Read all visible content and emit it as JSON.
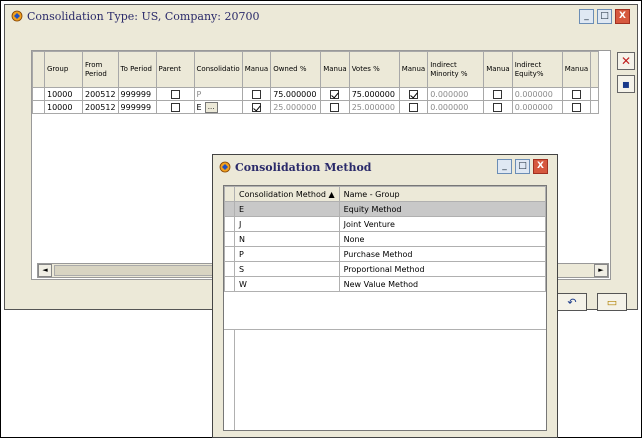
{
  "main_window": {
    "title": "Consolidation Type: US, Company: 20700",
    "controls": {
      "min": "_",
      "max": "□",
      "close": "X"
    }
  },
  "grid": {
    "headers": [
      "Group",
      "From Period",
      "To Period",
      "Parent",
      "Consolidatio",
      "Manua",
      "Owned %",
      "Manua",
      "Votes %",
      "Manua",
      "Indirect Minority %",
      "Manua",
      "Indirect Equity%",
      "Manua",
      ""
    ],
    "rows": [
      {
        "group": "10000",
        "from": "200512",
        "to": "999999",
        "parent": false,
        "consol": "P",
        "m1": false,
        "owned": "75.000000",
        "m2": true,
        "votes": "75.000000",
        "m3": true,
        "minority": "0.000000",
        "m4": false,
        "equity": "0.000000",
        "m5": false
      },
      {
        "group": "10000",
        "from": "200512",
        "to": "999999",
        "parent": false,
        "consol": "E",
        "m1": true,
        "owned": "25.000000",
        "m2": false,
        "votes": "25.000000",
        "m3": false,
        "minority": "0.000000",
        "m4": false,
        "equity": "0.000000",
        "m5": false
      }
    ]
  },
  "side_buttons": {
    "delete": "✕",
    "save": "▪"
  },
  "footer_buttons": {
    "undo": "↶",
    "open": "▭"
  },
  "popup": {
    "title": "Consolidation Method",
    "controls": {
      "min": "_",
      "max": "□",
      "close": "X"
    },
    "headers": {
      "code": "Consolidation Method ▲",
      "name": "Name - Group"
    },
    "rows": [
      {
        "code": "E",
        "name": "Equity Method",
        "selected": true
      },
      {
        "code": "J",
        "name": "Joint Venture",
        "selected": false
      },
      {
        "code": "N",
        "name": "None",
        "selected": false
      },
      {
        "code": "P",
        "name": "Purchase Method",
        "selected": false
      },
      {
        "code": "S",
        "name": "Proportional Method",
        "selected": false
      },
      {
        "code": "W",
        "name": "New Value Method",
        "selected": false
      }
    ]
  },
  "colors": {
    "window_bg": "#ece9d8",
    "title_text": "#2a2a6a",
    "close_red": "#d6583e",
    "selection": "#c8c8c8"
  }
}
